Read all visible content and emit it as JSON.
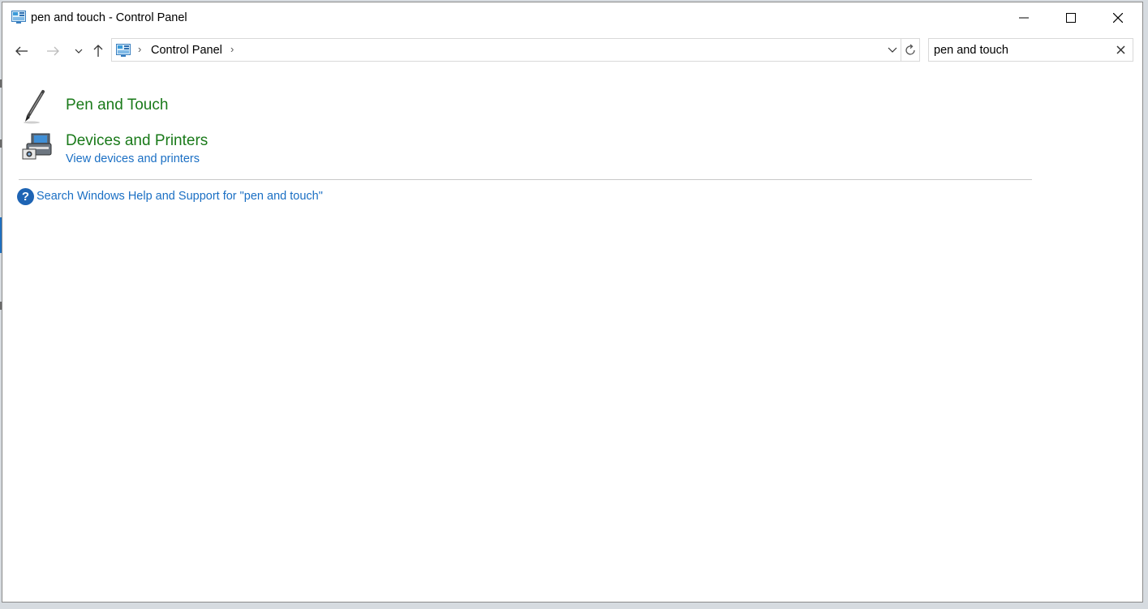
{
  "window": {
    "title": "pen and touch - Control Panel"
  },
  "address_bar": {
    "breadcrumb": "Control Panel"
  },
  "search": {
    "value": "pen and touch"
  },
  "results": [
    {
      "title": "Pen and Touch",
      "icon": "pen-icon"
    },
    {
      "title": "Devices and Printers",
      "subtitle": "View devices and printers",
      "icon": "devices-printers-icon"
    }
  ],
  "help": {
    "text": "Search Windows Help and Support for \"pen and touch\""
  },
  "colors": {
    "category_green": "#1a7a1a",
    "link_blue": "#1a6fc4",
    "help_icon_blue": "#1e64b4"
  }
}
